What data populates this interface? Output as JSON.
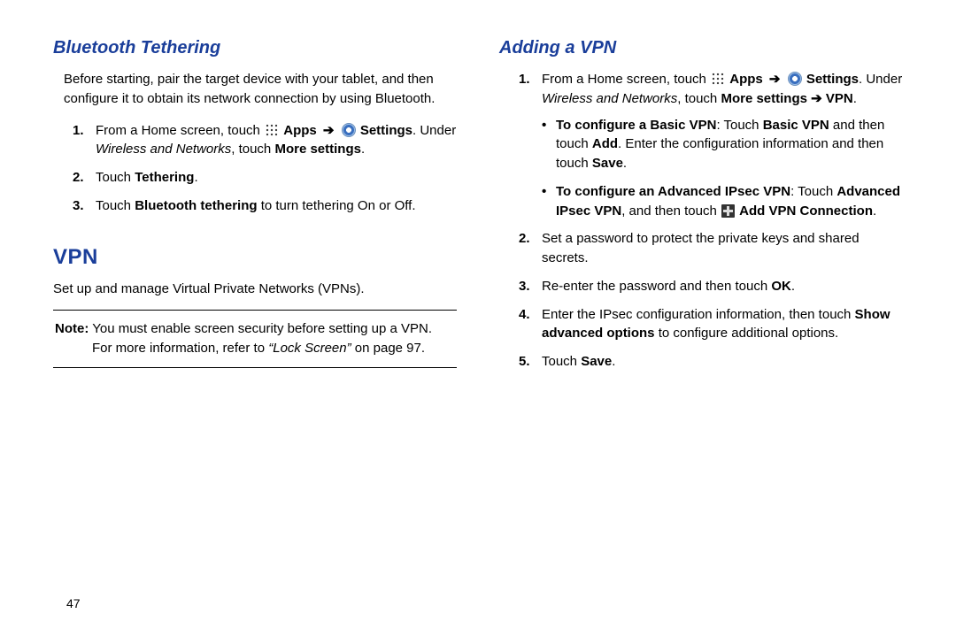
{
  "page_number": "47",
  "left": {
    "heading_bt": "Bluetooth Tethering",
    "bt_intro": "Before starting, pair the target device with your tablet, and then configure it to obtain its network connection by using Bluetooth.",
    "bt_steps": [
      {
        "num": "1.",
        "pre": "From a Home screen, touch ",
        "apps": "Apps",
        "arrow1": " ➔ ",
        "settings": "Settings",
        "post1": ". Under ",
        "wireless": "Wireless and Networks",
        "post2": ", touch ",
        "more": "More settings",
        "end": "."
      },
      {
        "num": "2.",
        "pre": "Touch ",
        "tethering": "Tethering",
        "end": "."
      },
      {
        "num": "3.",
        "pre": "Touch ",
        "btt": "Bluetooth tethering",
        "post": " to turn tethering On or Off."
      }
    ],
    "vpn_title": "VPN",
    "vpn_intro": "Set up and manage Virtual Private Networks (VPNs).",
    "note_label": "Note:",
    "note_body1": " You must enable screen security before setting up a VPN. For more information, refer to ",
    "note_ref": "“Lock Screen”",
    "note_body2": " on page 97."
  },
  "right": {
    "heading_add": "Adding a VPN",
    "step1": {
      "num": "1.",
      "pre": "From a Home screen, touch ",
      "apps": "Apps",
      "arrow1": " ➔ ",
      "settings": "Settings",
      "post1": ". Under ",
      "wireless": "Wireless and Networks",
      "post2": ", touch ",
      "more_vpn": "More settings ➔ VPN",
      "end": "."
    },
    "bullet_basic_lbl": "To configure a Basic VPN",
    "bullet_basic_t1": ": Touch ",
    "bullet_basic_b1": "Basic VPN",
    "bullet_basic_t2": " and then touch ",
    "bullet_basic_b2": "Add",
    "bullet_basic_t3": ". Enter the configuration information and then touch ",
    "bullet_basic_b3": "Save",
    "bullet_basic_end": ".",
    "bullet_adv_lbl": "To configure an Advanced IPsec VPN",
    "bullet_adv_t1": ": Touch ",
    "bullet_adv_b1": "Advanced IPsec VPN",
    "bullet_adv_t2": ", and then touch ",
    "bullet_adv_b2": "Add VPN Connection",
    "bullet_adv_end": ".",
    "step2": {
      "num": "2.",
      "text": "Set a password to protect the private keys and shared secrets."
    },
    "step3": {
      "num": "3.",
      "pre": "Re-enter the password and then touch ",
      "ok": "OK",
      "end": "."
    },
    "step4": {
      "num": "4.",
      "pre": "Enter the IPsec configuration information, then touch ",
      "b": "Show advanced options",
      "post": " to configure additional options."
    },
    "step5": {
      "num": "5.",
      "pre": "Touch ",
      "b": "Save",
      "end": "."
    }
  }
}
